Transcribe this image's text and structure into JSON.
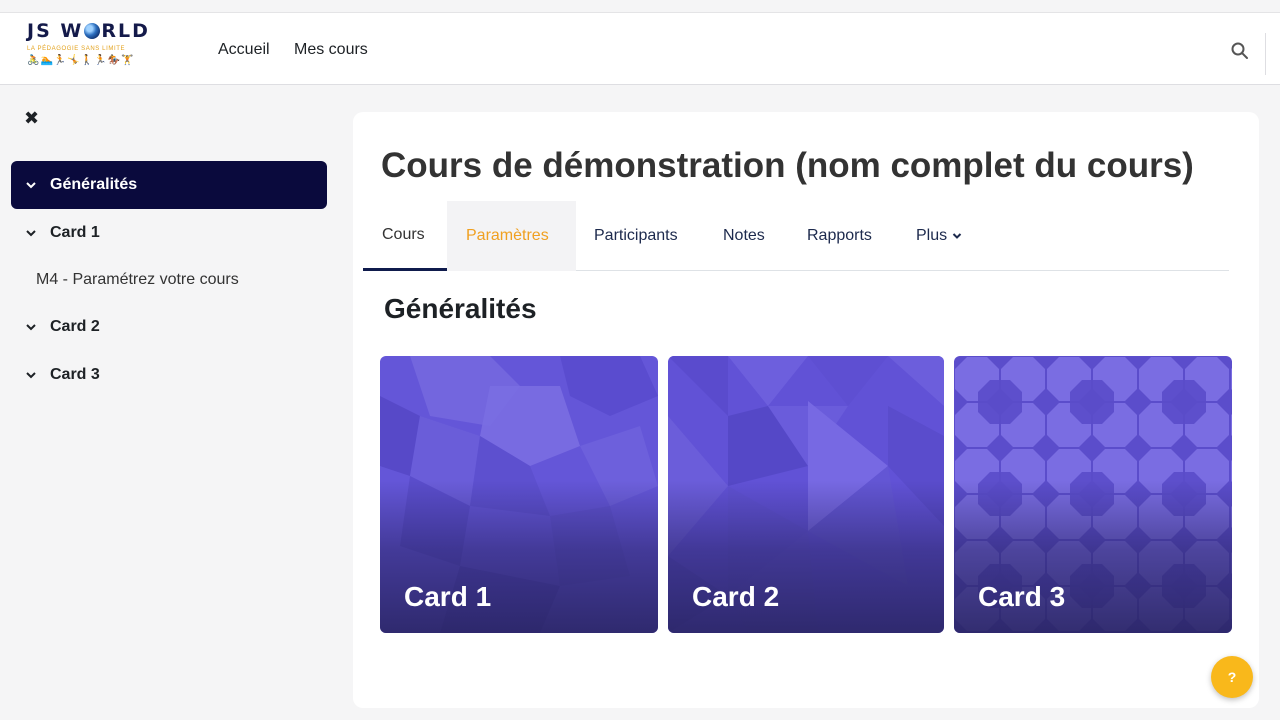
{
  "brand": {
    "title_left": "JS W",
    "title_right": "RLD",
    "subtitle": "LA PÉDAGOGIE SANS LIMITE",
    "figures": "🚴🏊🏃🤸🚶🏃🏇🏋"
  },
  "nav": {
    "home": "Accueil",
    "my_courses": "Mes cours"
  },
  "drawer": {
    "items": [
      {
        "label": "Généralités",
        "active": true
      },
      {
        "label": "Card 1"
      },
      {
        "label": "Card 2"
      },
      {
        "label": "Card 3"
      }
    ],
    "sub_item": "M4 - Paramétrez votre cours"
  },
  "course": {
    "title": "Cours de démonstration (nom complet du cours)",
    "tabs": [
      "Cours",
      "Paramètres",
      "Participants",
      "Notes",
      "Rapports",
      "Plus"
    ],
    "section_title": "Généralités",
    "cards": [
      "Card 1",
      "Card 2",
      "Card 3"
    ]
  },
  "help": {
    "label": "?"
  },
  "colors": {
    "accent_dark": "#0a0a3d",
    "tab_active_text": "#f0a020",
    "card_purple": "#6456d8",
    "help_button": "#f9b81b"
  }
}
